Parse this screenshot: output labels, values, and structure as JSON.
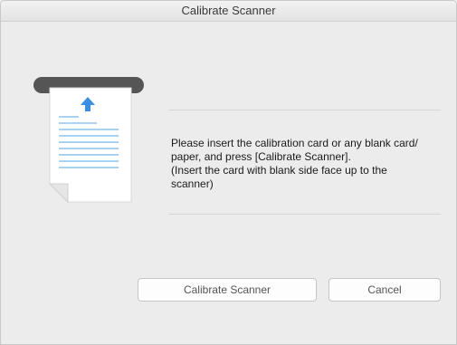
{
  "window": {
    "title": "Calibrate Scanner"
  },
  "illustration": {
    "icon": "paper-feed-icon",
    "colors": {
      "slot": "#555555",
      "arrow": "#3b8fe0",
      "lines": "#a9d2f0",
      "paper": "#ffffff"
    }
  },
  "message": {
    "lines": [
      "Please insert the calibration card or any blank card/",
      "paper, and press [Calibrate Scanner].",
      "(Insert the card with blank side face up to the",
      "scanner)"
    ]
  },
  "buttons": {
    "calibrate_label": "Calibrate Scanner",
    "cancel_label": "Cancel"
  }
}
